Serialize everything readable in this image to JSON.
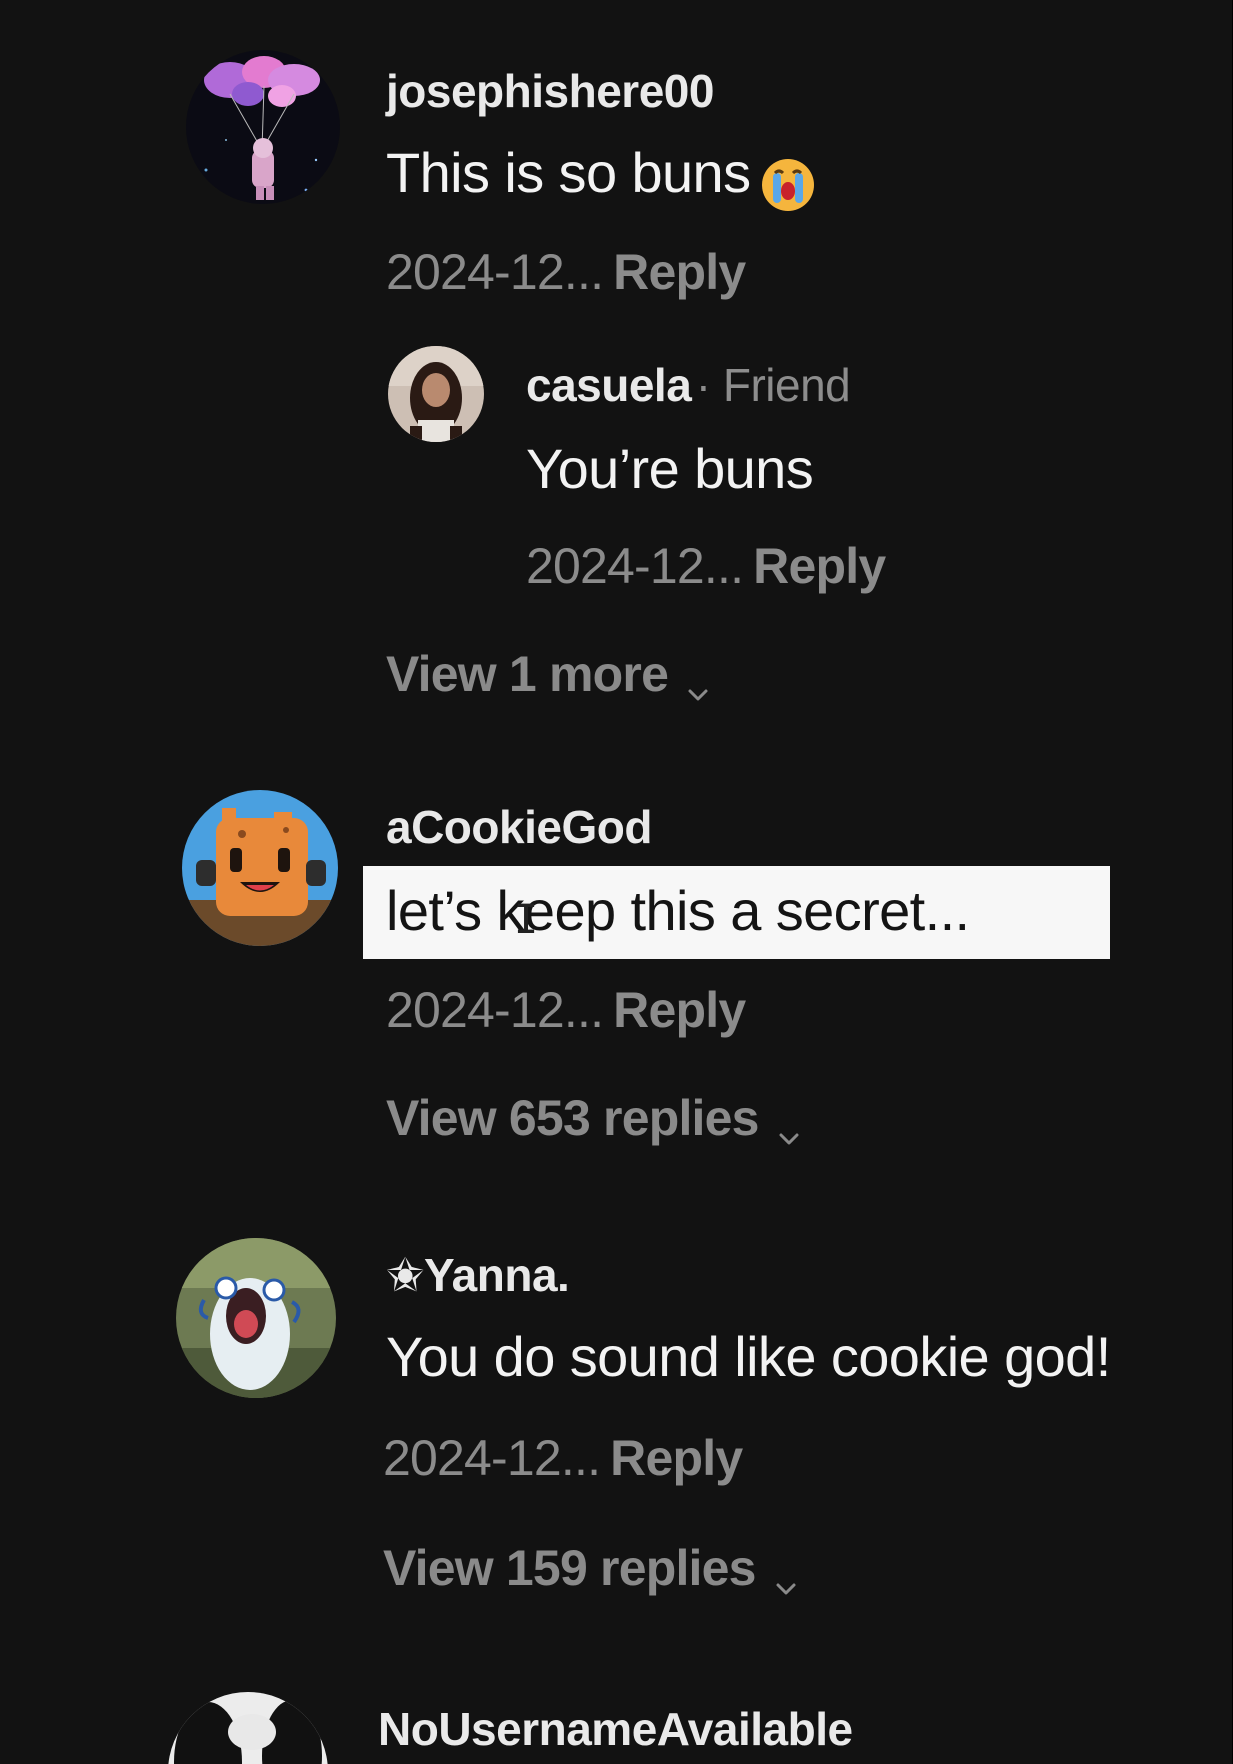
{
  "comments": [
    {
      "username": "josephishere00",
      "text": "This is so buns",
      "emoji": "loudly-crying-face-emoji",
      "date": "2024-12...",
      "reply_label": "Reply",
      "avatar": "avatar-balloons-astronaut",
      "replies": [
        {
          "username": "casuela",
          "tag": "· Friend",
          "text": "You’re buns",
          "date": "2024-12...",
          "reply_label": "Reply",
          "avatar": "avatar-person-photo"
        }
      ],
      "view_more_label": "View 1 more"
    },
    {
      "username": "aCookieGod",
      "text": "let’s keep this a secret...",
      "text_highlighted": true,
      "date": "2024-12...",
      "reply_label": "Reply",
      "avatar": "avatar-cookie-character",
      "view_more_label": "View 653 replies"
    },
    {
      "username": "✬Yanna.",
      "text": "You do sound like cookie god!",
      "date": "2024-12...",
      "reply_label": "Reply",
      "avatar": "avatar-screaming-creature",
      "view_more_label": "View 159 replies"
    },
    {
      "username": "NoUsernameAvailable",
      "avatar": "avatar-black-white-cat"
    }
  ],
  "colors": {
    "background": "#121212",
    "username": "#e9e9e9",
    "text": "#f3f3f3",
    "meta": "#8b8b8b",
    "highlight": "#f7f7f7"
  }
}
